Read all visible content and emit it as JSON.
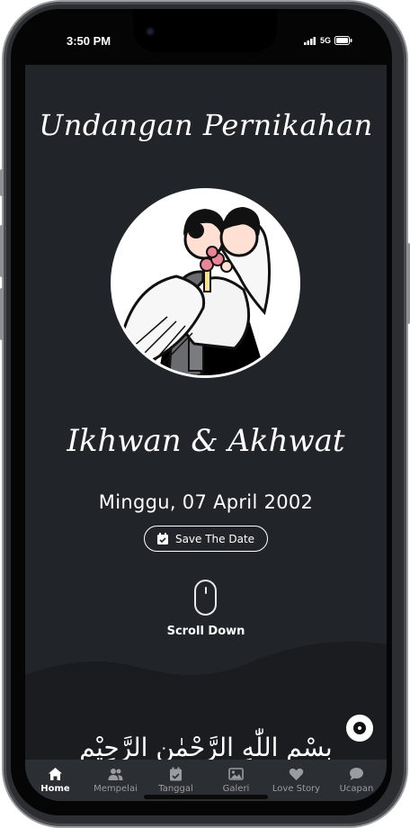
{
  "status_bar": {
    "time": "3:50 PM",
    "network": "5G",
    "icons": [
      "signal-icon",
      "battery-icon"
    ]
  },
  "invitation": {
    "title": "Undangan Pernikahan",
    "couple": "Ikhwan & Akhwat",
    "date": "Minggu, 07 April 2002",
    "save_date_label": "Save The Date",
    "scroll_label": "Scroll Down",
    "bismillah": "بِسْمِ اللّٰهِ الرَّحْمٰنِ الرَّحِيْمِ",
    "photo_icon": "couple-illustration"
  },
  "nav": {
    "items": [
      {
        "label": "Home",
        "icon": "home-icon",
        "active": true
      },
      {
        "label": "Mempelai",
        "icon": "users-icon",
        "active": false
      },
      {
        "label": "Tanggal",
        "icon": "calendar-icon",
        "active": false
      },
      {
        "label": "Galeri",
        "icon": "image-icon",
        "active": false
      },
      {
        "label": "Love Story",
        "icon": "heart-icon",
        "active": false
      },
      {
        "label": "Ucapan",
        "icon": "chat-icon",
        "active": false
      }
    ]
  },
  "colors": {
    "background": "#212428",
    "wave": "#1a1c1f",
    "text": "#ffffff",
    "nav_inactive": "#9a9ca0"
  }
}
